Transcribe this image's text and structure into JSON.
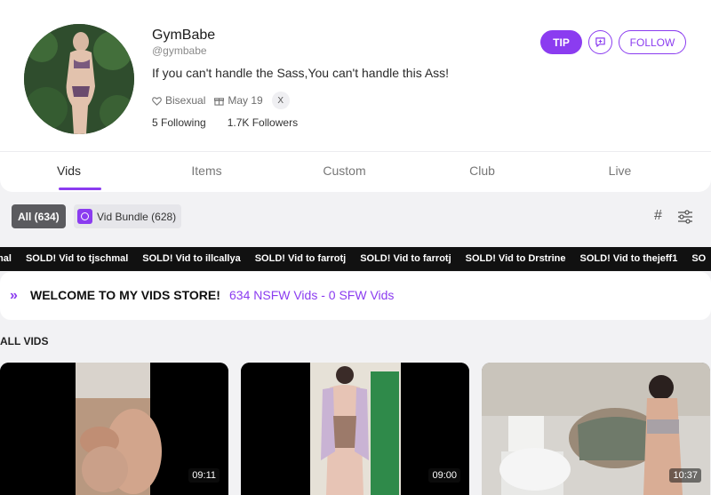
{
  "profile": {
    "name": "GymBabe",
    "handle": "@gymbabe",
    "bio": "If you can't handle the Sass,You can't handle this Ass!",
    "orientation": "Bisexual",
    "birthday": "May 19",
    "social": "X",
    "following": "5 Following",
    "followers": "1.7K Followers"
  },
  "actions": {
    "tip": "TIP",
    "follow": "FOLLOW"
  },
  "tabs": [
    "Vids",
    "Items",
    "Custom",
    "Club",
    "Live"
  ],
  "filters": {
    "all": "All (634)",
    "bundle": "Vid Bundle (628)",
    "hash": "#"
  },
  "ticker": [
    "mal",
    "SOLD! Vid to tjschmal",
    "SOLD! Vid to illcallya",
    "SOLD! Vid to farrotj",
    "SOLD! Vid to farrotj",
    "SOLD! Vid to Drstrine",
    "SOLD! Vid to thejeff1",
    "SO"
  ],
  "welcome": {
    "arrows": "»",
    "title": "WELCOME TO MY VIDS STORE!",
    "counts": "634 NSFW Vids - 0 SFW Vids"
  },
  "section_title": "ALL VIDS",
  "videos": [
    {
      "duration": "09:11"
    },
    {
      "duration": "09:00"
    },
    {
      "duration": "10:37"
    }
  ],
  "colors": {
    "accent": "#8b3cf0",
    "ticker_bg": "#111111",
    "page_bg": "#f2f2f4"
  }
}
